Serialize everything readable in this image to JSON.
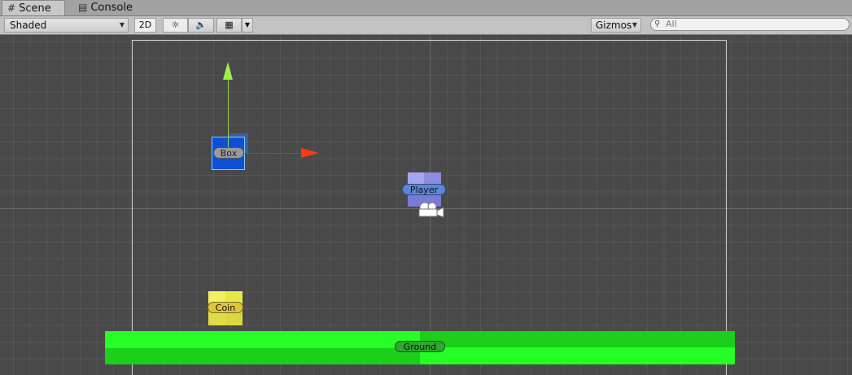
{
  "tabs": [
    {
      "label": "Scene",
      "icon": "grid-icon"
    },
    {
      "label": "Console",
      "icon": "console-icon"
    }
  ],
  "toolbar": {
    "shading_mode": "Shaded",
    "mode_2d_label": "2D",
    "lighting_icon": "sun-icon",
    "audio_icon": "speaker-icon",
    "effects_icon": "image-icon",
    "gizmos_label": "Gizmos",
    "search_placeholder": "All"
  },
  "scene": {
    "objects": [
      {
        "name": "Box",
        "color": "#0f4fd6"
      },
      {
        "name": "Player",
        "color": "#7a7ad8"
      },
      {
        "name": "Coin",
        "color": "#f0f062"
      },
      {
        "name": "Ground",
        "color": "#25ff25"
      }
    ],
    "gizmo_colors": {
      "y_axis": "#9ef047",
      "x_axis": "#ff3a14"
    }
  }
}
